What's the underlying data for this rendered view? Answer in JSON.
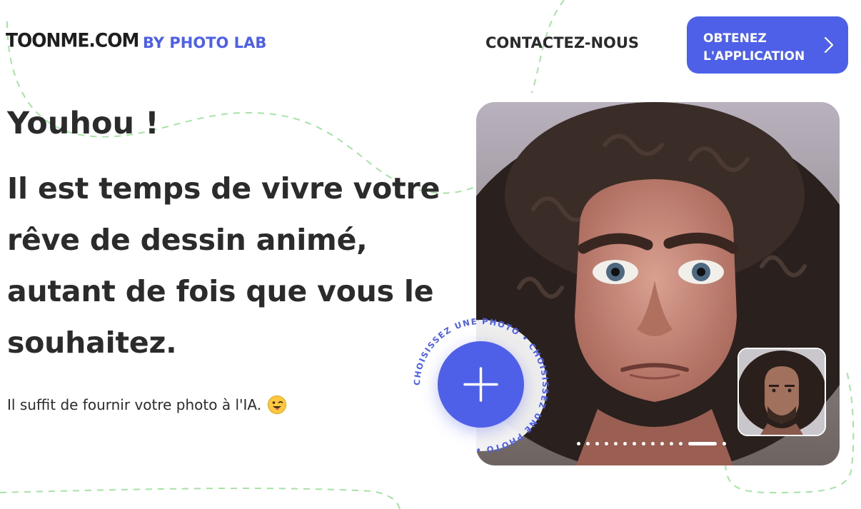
{
  "brand": {
    "logo": "TOONME.COM",
    "byline": "BY PHOTO LAB"
  },
  "nav": {
    "contact": "CONTACTEZ-NOUS",
    "cta_line1": "OBTENEZ",
    "cta_line2": "L'APPLICATION"
  },
  "hero": {
    "greeting": "Youhou !",
    "headline": "Il est temps de vivre votre rêve de dessin animé, autant de fois que vous le souhaitez.",
    "subtext": "Il suffit de fournir votre photo à l'IA.",
    "upload_ring_text": "CHOISISSEZ UNE PHOTO • CHOISISSEZ UNE PHOTO •"
  },
  "carousel": {
    "slide_count": 14,
    "active_index": 12
  },
  "colors": {
    "accent": "#4e5fe8",
    "text": "#2b2b2b",
    "deco_green": "#9ee0a0"
  },
  "icons": {
    "cta": "chevron-right-icon",
    "upload": "plus-icon",
    "emoji": "winking-tongue-emoji-icon"
  }
}
